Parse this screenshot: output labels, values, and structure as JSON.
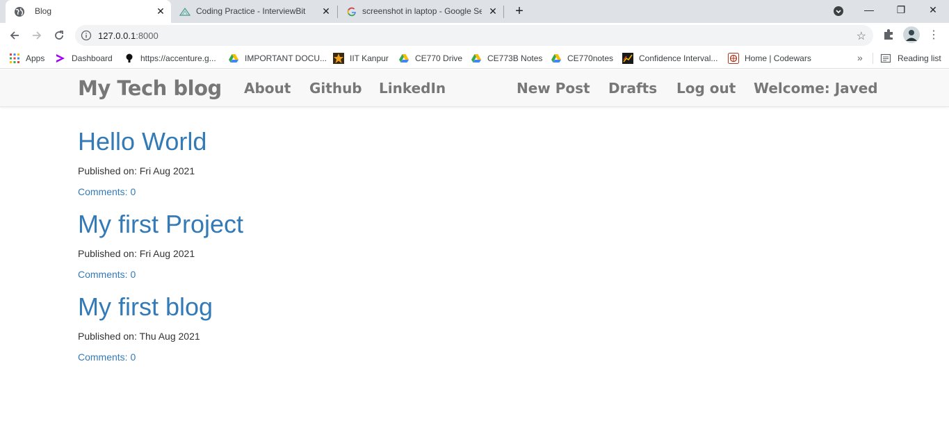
{
  "browser": {
    "tabs": [
      {
        "title": "Blog",
        "active": true
      },
      {
        "title": "Coding Practice - InterviewBit",
        "active": false
      },
      {
        "title": "screenshot in laptop - Google Se",
        "active": false
      }
    ],
    "url_host": "127.0.0.1",
    "url_port": ":8000",
    "bookmarks": [
      {
        "label": "Apps",
        "icon": "apps-grid-icon"
      },
      {
        "label": "Dashboard",
        "icon": "accenture-icon"
      },
      {
        "label": "https://accenture.g...",
        "icon": "bulb-icon"
      },
      {
        "label": "IMPORTANT DOCU...",
        "icon": "google-drive-icon"
      },
      {
        "label": "IIT Kanpur",
        "icon": "iitk-icon"
      },
      {
        "label": "CE770 Drive",
        "icon": "google-drive-icon"
      },
      {
        "label": "CE773B Notes",
        "icon": "google-drive-icon"
      },
      {
        "label": "CE770notes",
        "icon": "google-drive-icon"
      },
      {
        "label": "Confidence Interval...",
        "icon": "chart-icon"
      },
      {
        "label": "Home | Codewars",
        "icon": "codewars-icon"
      }
    ],
    "reading_list": "Reading list",
    "more": "»"
  },
  "site": {
    "brand": "My Tech blog",
    "nav_left": [
      "About",
      "Github",
      "LinkedIn"
    ],
    "nav_right": [
      "New Post",
      "Drafts",
      "Log out",
      "Welcome: Javed"
    ]
  },
  "posts": [
    {
      "title": "Hello World",
      "published": "Published on: Fri Aug 2021",
      "comments": "Comments: 0"
    },
    {
      "title": "My first Project",
      "published": "Published on: Fri Aug 2021",
      "comments": "Comments: 0"
    },
    {
      "title": "My first blog",
      "published": "Published on: Thu Aug 2021",
      "comments": "Comments: 0"
    }
  ],
  "colors": {
    "link": "#337ab7",
    "navbar_bg": "#f8f8f8",
    "nav_text": "#777777",
    "tabstrip_bg": "#dee1e6"
  }
}
